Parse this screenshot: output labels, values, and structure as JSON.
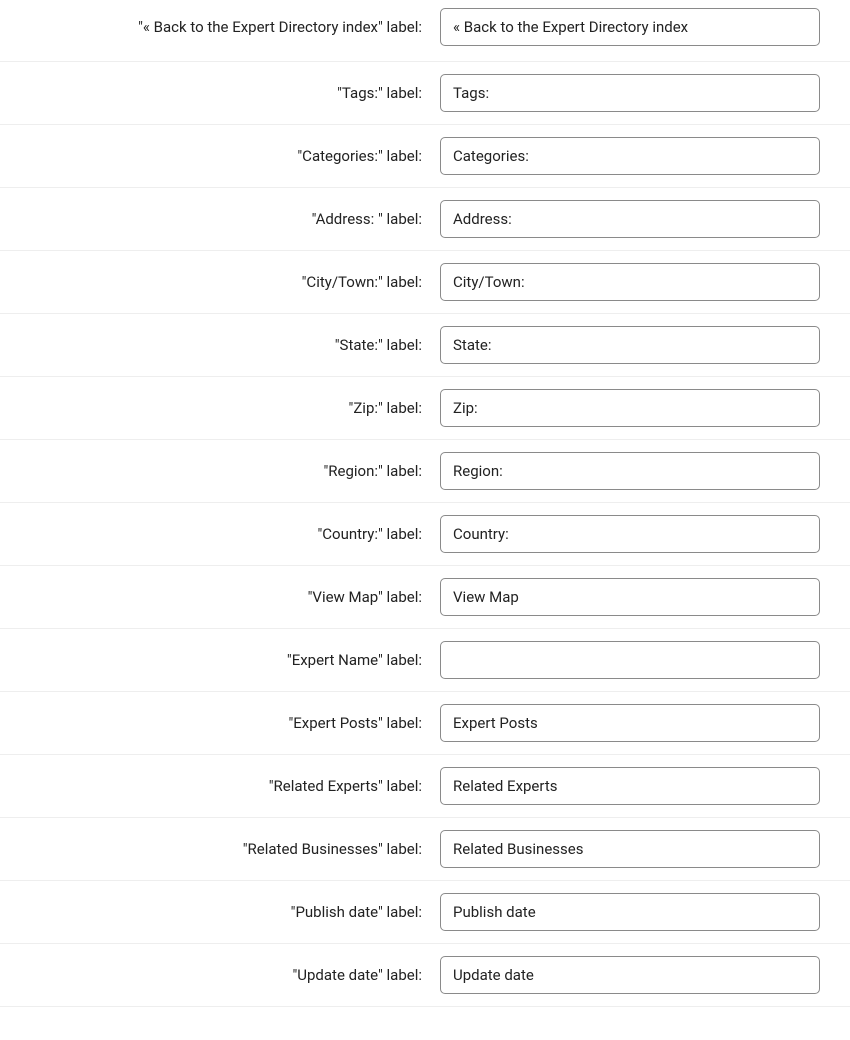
{
  "suffix": " label:",
  "rows": [
    {
      "key": "back",
      "label_text": "« Back to the Expert Directory index",
      "value": "« Back to the Expert Directory index"
    },
    {
      "key": "tags",
      "label_text": "Tags:",
      "value": "Tags:"
    },
    {
      "key": "categories",
      "label_text": "Categories:",
      "value": "Categories:"
    },
    {
      "key": "address",
      "label_text": "Address: ",
      "value": "Address:"
    },
    {
      "key": "city-town",
      "label_text": "City/Town:",
      "value": "City/Town:"
    },
    {
      "key": "state",
      "label_text": "State:",
      "value": "State:"
    },
    {
      "key": "zip",
      "label_text": "Zip:",
      "value": "Zip:"
    },
    {
      "key": "region",
      "label_text": "Region:",
      "value": "Region:"
    },
    {
      "key": "country",
      "label_text": "Country:",
      "value": "Country:"
    },
    {
      "key": "view-map",
      "label_text": "View Map",
      "value": "View Map"
    },
    {
      "key": "expert-name",
      "label_text": "Expert Name",
      "value": ""
    },
    {
      "key": "expert-posts",
      "label_text": "Expert Posts",
      "value": "Expert Posts"
    },
    {
      "key": "related-experts",
      "label_text": "Related Experts",
      "value": "Related Experts"
    },
    {
      "key": "related-businesses",
      "label_text": "Related Businesses",
      "value": "Related Businesses"
    },
    {
      "key": "publish-date",
      "label_text": "Publish date",
      "value": "Publish date"
    },
    {
      "key": "update-date",
      "label_text": "Update date",
      "value": "Update date"
    }
  ]
}
